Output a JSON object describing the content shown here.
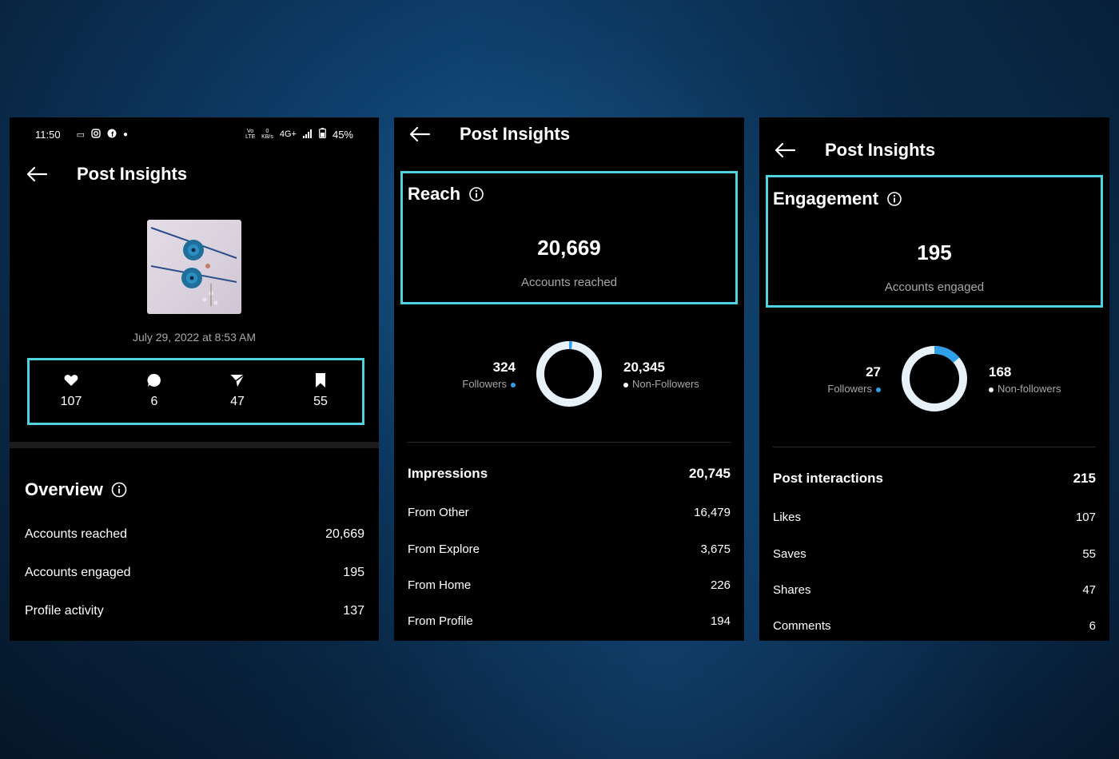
{
  "left_panel": {
    "status_bar": {
      "time": "11:50",
      "volte": "Vo LTE",
      "speed_top": "0",
      "speed_bottom": "KB/s",
      "network": "4G+",
      "battery": "45%"
    },
    "header_title": "Post Insights",
    "post_date": "July 29, 2022 at 8:53 AM",
    "stats": [
      {
        "icon": "heart-icon",
        "value": "107"
      },
      {
        "icon": "comment-icon",
        "value": "6"
      },
      {
        "icon": "send-icon",
        "value": "47"
      },
      {
        "icon": "bookmark-icon",
        "value": "55"
      }
    ],
    "overview": {
      "title": "Overview",
      "rows": [
        {
          "label": "Accounts reached",
          "value": "20,669"
        },
        {
          "label": "Accounts engaged",
          "value": "195"
        },
        {
          "label": "Profile activity",
          "value": "137"
        }
      ]
    }
  },
  "middle_panel": {
    "header_title": "Post Insights",
    "reach": {
      "title": "Reach",
      "value": "20,669",
      "subtitle": "Accounts reached"
    },
    "donut": {
      "followers_value": "324",
      "followers_label": "Followers",
      "nonfollowers_value": "20,345",
      "nonfollowers_label": "Non-Followers",
      "followers_fraction": 0.0157
    },
    "impressions": {
      "title": "Impressions",
      "total": "20,745",
      "rows": [
        {
          "label": "From Other",
          "value": "16,479"
        },
        {
          "label": "From Explore",
          "value": "3,675"
        },
        {
          "label": "From Home",
          "value": "226"
        },
        {
          "label": "From Profile",
          "value": "194"
        }
      ]
    }
  },
  "right_panel": {
    "header_title": "Post Insights",
    "engagement": {
      "title": "Engagement",
      "value": "195",
      "subtitle": "Accounts engaged"
    },
    "donut": {
      "followers_value": "27",
      "followers_label": "Followers",
      "nonfollowers_value": "168",
      "nonfollowers_label": "Non-followers",
      "followers_fraction": 0.138
    },
    "interactions": {
      "title": "Post interactions",
      "total": "215",
      "rows": [
        {
          "label": "Likes",
          "value": "107"
        },
        {
          "label": "Saves",
          "value": "55"
        },
        {
          "label": "Shares",
          "value": "47"
        },
        {
          "label": "Comments",
          "value": "6"
        }
      ]
    }
  },
  "colors": {
    "highlight": "#4fd3e0",
    "followers": "#2e9fe8",
    "nonfollowers": "#e6f1fa",
    "panel": "#000000"
  }
}
